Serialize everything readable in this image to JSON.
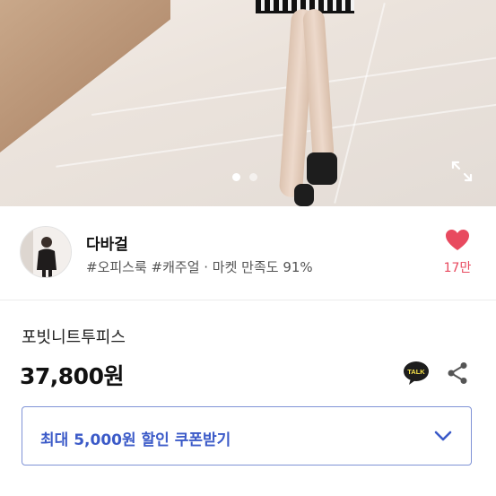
{
  "gallery": {
    "slide_count": 3,
    "active_slide": 1
  },
  "seller": {
    "name": "다바걸",
    "tags": "#오피스룩 #캐주얼 · 마켓 만족도 91%",
    "like_count": "17만"
  },
  "product": {
    "name": "포빗니트투피스",
    "price": "37,800원"
  },
  "actions": {
    "talk_label": "TALK"
  },
  "coupon": {
    "label": "최대 5,000원 할인 쿠폰받기"
  },
  "colors": {
    "accent_blue": "#3b5ac8",
    "heart_red": "#e84a5f",
    "talk_yellow": "#1d1d1d"
  }
}
